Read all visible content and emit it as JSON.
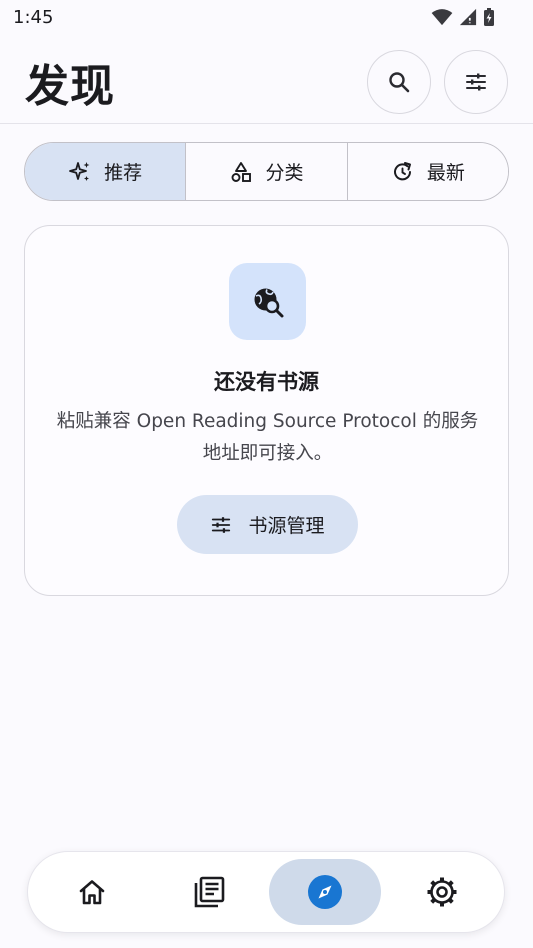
{
  "status_bar": {
    "time": "1:45"
  },
  "header": {
    "title": "发现"
  },
  "tabs": [
    {
      "label": "推荐",
      "icon": "sparkle-icon",
      "active": true
    },
    {
      "label": "分类",
      "icon": "shapes-icon",
      "active": false
    },
    {
      "label": "最新",
      "icon": "refresh-icon",
      "active": false
    }
  ],
  "empty_state": {
    "icon": "travel-explore-icon",
    "title": "还没有书源",
    "description": "粘贴兼容 Open Reading Source Protocol 的服务地址即可接入。",
    "button_label": "书源管理"
  },
  "bottom_nav": [
    {
      "icon": "home-icon"
    },
    {
      "icon": "library-icon"
    },
    {
      "icon": "compass-icon",
      "active": true
    },
    {
      "icon": "gear-icon"
    }
  ],
  "colors": {
    "accent": "#1976d2",
    "active_tint": "#d8e2f3",
    "background": "#fbfafe"
  }
}
